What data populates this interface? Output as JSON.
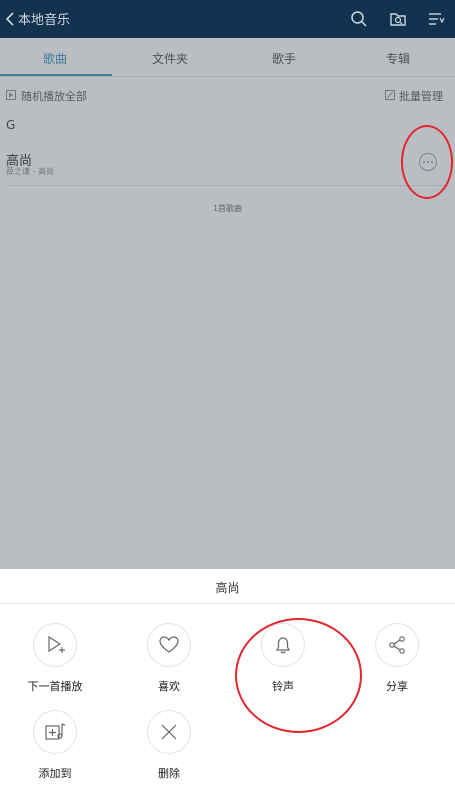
{
  "header": {
    "title": "本地音乐",
    "icons": [
      "back-icon",
      "search-icon",
      "folder-search-icon",
      "sort-icon"
    ]
  },
  "tabs": [
    {
      "label": "歌曲",
      "active": true
    },
    {
      "label": "文件夹",
      "active": false
    },
    {
      "label": "歌手",
      "active": false
    },
    {
      "label": "专辑",
      "active": false
    }
  ],
  "toolbar": {
    "shuffle_label": "随机播放全部",
    "batch_label": "批量管理"
  },
  "group_letter": "G",
  "song": {
    "title": "高尚",
    "subtitle": "薛之谦 - 高尚"
  },
  "song_count": "1首歌曲",
  "sheet": {
    "title": "高尚",
    "actions": [
      {
        "label": "下一首播放",
        "icon": "play-next-icon"
      },
      {
        "label": "喜欢",
        "icon": "heart-icon"
      },
      {
        "label": "铃声",
        "icon": "bell-icon"
      },
      {
        "label": "分享",
        "icon": "share-icon"
      },
      {
        "label": "添加到",
        "icon": "add-to-playlist-icon"
      },
      {
        "label": "删除",
        "icon": "close-icon"
      }
    ]
  },
  "colors": {
    "header_bg": "#13324f",
    "accent": "#2a8fbf",
    "annotation": "#e3262f"
  }
}
